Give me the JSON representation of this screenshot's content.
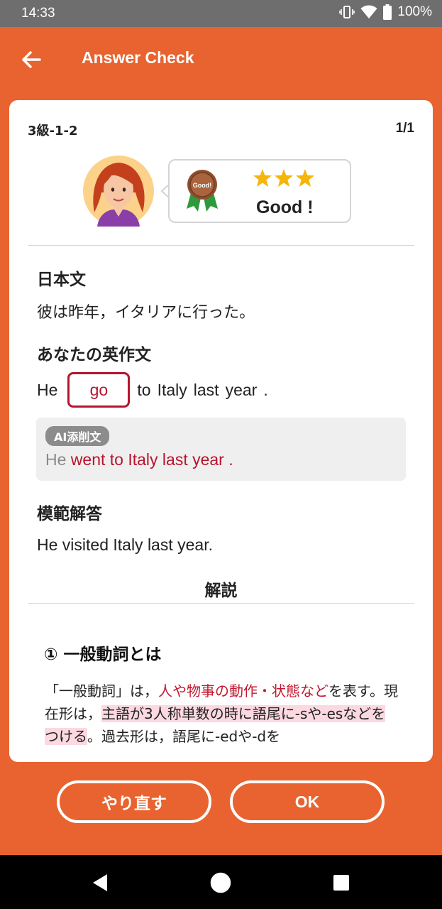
{
  "status_bar": {
    "time": "14:33",
    "battery": "100%",
    "icons": [
      "vibrate-icon",
      "wifi-icon",
      "battery-icon"
    ]
  },
  "app_bar": {
    "title": "Answer Check",
    "back_icon": "arrow-left-icon"
  },
  "card": {
    "level": "3級-1-2",
    "page": "1/1",
    "feedback": {
      "medal_label": "Good!",
      "stars": 3,
      "rating_text": "Good !"
    },
    "japanese": {
      "label": "日本文",
      "sentence": "彼は昨年，イタリアに行った。"
    },
    "your_answer": {
      "label": "あなたの英作文",
      "prefix": "He",
      "blank": "go",
      "words": [
        "to",
        "Italy",
        "last",
        "year",
        "."
      ]
    },
    "ai_correction": {
      "badge": "AI添削文",
      "gray_part": "He",
      "red_part": "went to Italy last year ."
    },
    "model_answer": {
      "label": "模範解答",
      "sentence": "He visited Italy last year."
    },
    "explanation": {
      "heading": "解説",
      "title": "① 一般動詞とは",
      "p1": "「一般動詞」は，",
      "p1_red": "人や物事の動作・状態など",
      "p1_end": "を表す。現在形は，",
      "p2_pink": "主語が3人称単数の時に語尾に-sや-esなどをつける",
      "p2_end": "。過去形は，語尾に-edや-dを"
    }
  },
  "buttons": {
    "retry": "やり直す",
    "ok": "OK"
  },
  "colors": {
    "primary": "#E8632F",
    "accent_red": "#B6152E",
    "star": "#F5B50C"
  }
}
